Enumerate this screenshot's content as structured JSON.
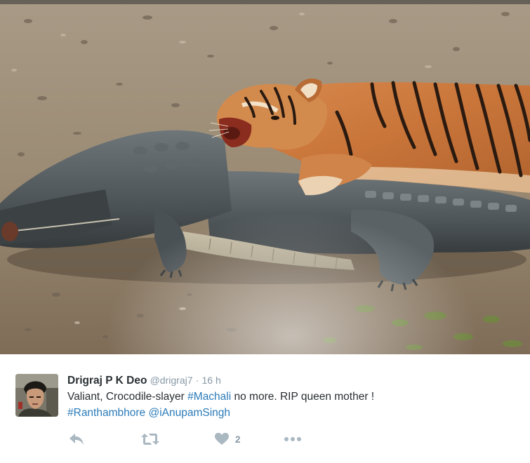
{
  "photo": {
    "icon": "photo-tiger-crocodile"
  },
  "tweet": {
    "author": {
      "name": "Drigraj P K Deo",
      "handle": "@drigraj7",
      "avatar_icon": "avatar"
    },
    "separator": "·",
    "timestamp": "16 h",
    "text": {
      "line1_prefix": "Valiant, Crocodile-slayer ",
      "line1_hashtag": "#Machali",
      "line1_suffix": " no more. RIP queen mother !",
      "line2_hashtag": "#Ranthambhore",
      "line2_space": " ",
      "line2_mention": "@iAnupamSingh"
    },
    "actions": {
      "reply_icon": "reply-icon",
      "retweet_icon": "retweet-icon",
      "like_icon": "heart-icon",
      "like_count": "2",
      "more_icon": "more-icon"
    },
    "colors": {
      "text": "#292f33",
      "link": "#2b7bb9",
      "muted": "#8899a6",
      "icon": "#aab8c2"
    }
  }
}
